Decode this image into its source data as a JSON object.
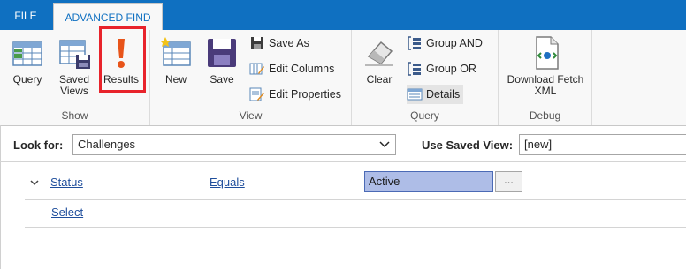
{
  "tabs": {
    "file": "FILE",
    "advanced_find": "ADVANCED FIND"
  },
  "ribbon": {
    "show": {
      "label": "Show",
      "query": "Query",
      "saved_views": "Saved\nViews",
      "results": "Results"
    },
    "view": {
      "label": "View",
      "new": "New",
      "save": "Save",
      "save_as": "Save As",
      "edit_columns": "Edit Columns",
      "edit_properties": "Edit Properties"
    },
    "query": {
      "label": "Query",
      "clear": "Clear",
      "group_and": "Group AND",
      "group_or": "Group OR",
      "details": "Details"
    },
    "debug": {
      "label": "Debug",
      "download_fetch_xml": "Download Fetch\nXML"
    }
  },
  "lookfor": {
    "label": "Look for:",
    "value": "Challenges"
  },
  "saved_view": {
    "label": "Use Saved View:",
    "value": "[new]"
  },
  "criteria": {
    "field": "Status",
    "operator": "Equals",
    "value": "Active",
    "ellipsis": "..."
  },
  "select_link": "Select",
  "colors": {
    "brand": "#0f70c1",
    "highlight": "#e8232b",
    "value_bg": "#aebde7"
  }
}
